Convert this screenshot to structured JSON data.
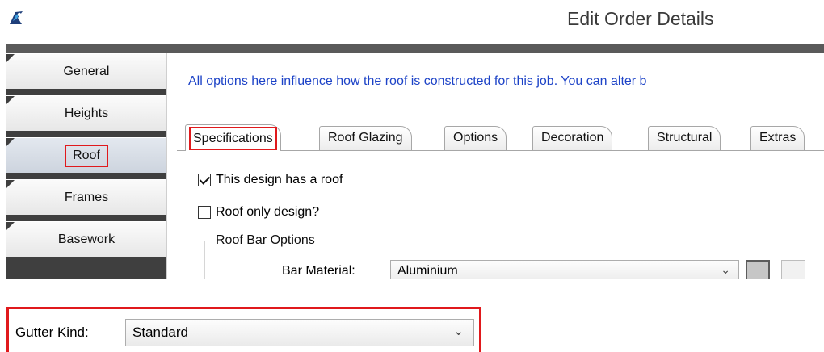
{
  "window": {
    "title": "Edit Order Details",
    "icon": "app-logo-icon"
  },
  "nav": {
    "items": [
      {
        "label": "General"
      },
      {
        "label": "Heights"
      },
      {
        "label": "Roof",
        "selected": true
      },
      {
        "label": "Frames"
      },
      {
        "label": "Basework"
      }
    ]
  },
  "content": {
    "info_text": "All options here influence how the roof is constructed for this job. You can alter b",
    "tabs": [
      {
        "label": "Specifications",
        "active": true
      },
      {
        "label": "Roof Glazing"
      },
      {
        "label": "Options"
      },
      {
        "label": "Decoration"
      },
      {
        "label": "Structural"
      },
      {
        "label": "Extras"
      }
    ],
    "has_roof": {
      "label": "This design has a roof",
      "checked": true
    },
    "roof_only": {
      "label": "Roof only design?",
      "checked": false
    },
    "roof_bar_options": {
      "title": "Roof Bar Options",
      "bar_material_label": "Bar Material:",
      "bar_material_value": "Aluminium"
    }
  },
  "gutter": {
    "label": "Gutter Kind:",
    "value": "Standard"
  },
  "colors": {
    "highlight": "#e0191c",
    "info_text": "#1d43c7",
    "nav_background": "#3f3f3f"
  }
}
